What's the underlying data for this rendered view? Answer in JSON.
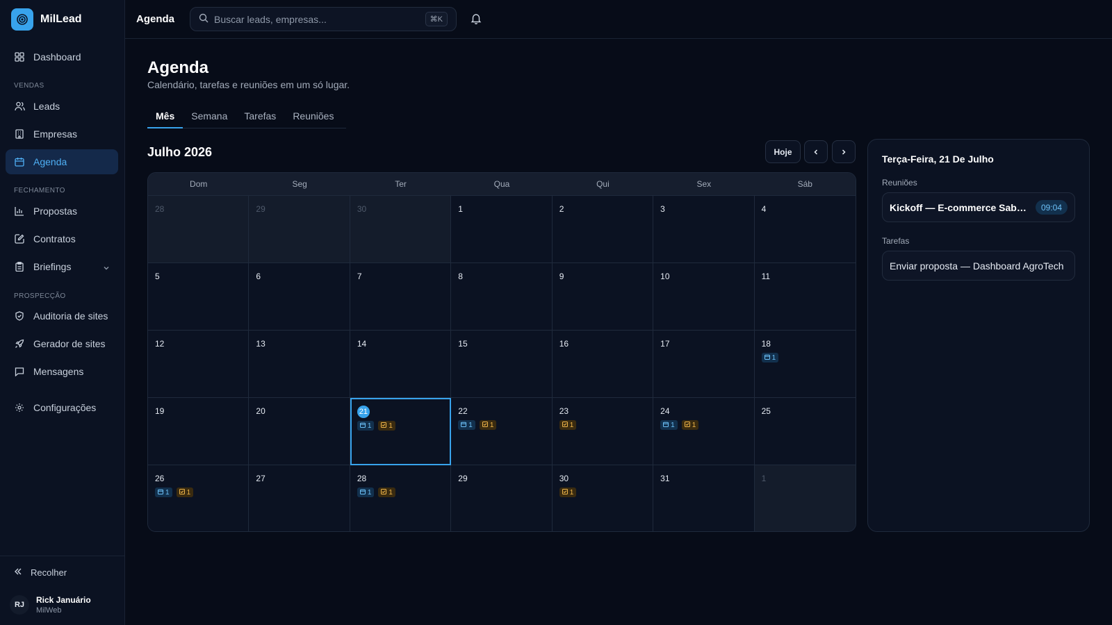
{
  "brand": {
    "name": "MilLead"
  },
  "sidebar": {
    "items": [
      {
        "key": "dashboard",
        "label": "Dashboard"
      },
      {
        "key": "leads",
        "label": "Leads"
      },
      {
        "key": "empresas",
        "label": "Empresas"
      },
      {
        "key": "agenda",
        "label": "Agenda"
      },
      {
        "key": "propostas",
        "label": "Propostas"
      },
      {
        "key": "contratos",
        "label": "Contratos"
      },
      {
        "key": "briefings",
        "label": "Briefings"
      },
      {
        "key": "auditoria",
        "label": "Auditoria de sites"
      },
      {
        "key": "gerador",
        "label": "Gerador de sites"
      },
      {
        "key": "mensagens",
        "label": "Mensagens"
      },
      {
        "key": "configuracoes",
        "label": "Configurações"
      }
    ],
    "sections": {
      "vendas": "VENDAS",
      "fechamento": "FECHAMENTO",
      "prospeccao": "PROSPECÇÃO"
    },
    "collapse_label": "Recolher",
    "user": {
      "initials": "RJ",
      "name": "Rick Januário",
      "org": "MilWeb"
    }
  },
  "topbar": {
    "title": "Agenda",
    "search_placeholder": "Buscar leads, empresas...",
    "shortcut": "⌘K"
  },
  "page": {
    "title": "Agenda",
    "subtitle": "Calendário, tarefas e reuniões em um só lugar.",
    "tabs": [
      "Mês",
      "Semana",
      "Tarefas",
      "Reuniões"
    ],
    "active_tab": "Mês"
  },
  "calendar": {
    "month_label": "Julho 2026",
    "today_label": "Hoje",
    "weekdays": [
      "Dom",
      "Seg",
      "Ter",
      "Qua",
      "Qui",
      "Sex",
      "Sáb"
    ],
    "days": [
      {
        "n": "28",
        "outside": true
      },
      {
        "n": "29",
        "outside": true
      },
      {
        "n": "30",
        "outside": true
      },
      {
        "n": "1"
      },
      {
        "n": "2"
      },
      {
        "n": "3"
      },
      {
        "n": "4"
      },
      {
        "n": "5"
      },
      {
        "n": "6"
      },
      {
        "n": "7"
      },
      {
        "n": "8"
      },
      {
        "n": "9"
      },
      {
        "n": "10"
      },
      {
        "n": "11"
      },
      {
        "n": "12"
      },
      {
        "n": "13"
      },
      {
        "n": "14"
      },
      {
        "n": "15"
      },
      {
        "n": "16"
      },
      {
        "n": "17"
      },
      {
        "n": "18",
        "meetings": "1"
      },
      {
        "n": "19"
      },
      {
        "n": "20"
      },
      {
        "n": "21",
        "meetings": "1",
        "tasks": "1",
        "today": true,
        "selected": true
      },
      {
        "n": "22",
        "meetings": "1",
        "tasks": "1"
      },
      {
        "n": "23",
        "tasks": "1"
      },
      {
        "n": "24",
        "meetings": "1",
        "tasks": "1"
      },
      {
        "n": "25"
      },
      {
        "n": "26",
        "meetings": "1",
        "tasks": "1"
      },
      {
        "n": "27"
      },
      {
        "n": "28",
        "meetings": "1",
        "tasks": "1"
      },
      {
        "n": "29"
      },
      {
        "n": "30",
        "tasks": "1"
      },
      {
        "n": "31"
      },
      {
        "n": "1",
        "outside": true
      }
    ]
  },
  "panel": {
    "date_title": "Terça-Feira, 21 De Julho",
    "meetings_label": "Reuniões",
    "meetings": [
      {
        "title": "Kickoff — E-commerce Sabor...",
        "time": "09:04"
      }
    ],
    "tasks_label": "Tarefas",
    "tasks": [
      {
        "title": "Enviar proposta — Dashboard AgroTech"
      }
    ]
  },
  "colors": {
    "accent": "#38a3ec",
    "meeting_badge": "#6cc0f7",
    "task_badge": "#f0b64a",
    "background": "#070c18"
  }
}
